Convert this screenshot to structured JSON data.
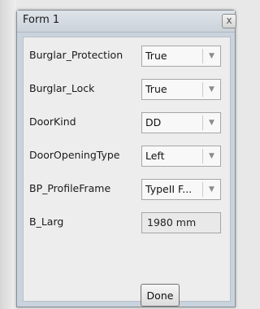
{
  "window": {
    "title": "Form 1",
    "close_symbol": "x"
  },
  "properties": [
    {
      "label": "Burglar_Protection",
      "control": "combo",
      "value": "True"
    },
    {
      "label": "Burglar_Lock",
      "control": "combo",
      "value": "True"
    },
    {
      "label": "DoorKind",
      "control": "combo",
      "value": "DD"
    },
    {
      "label": "DoorOpeningType",
      "control": "combo",
      "value": "Left"
    },
    {
      "label": "BP_ProfileFrame",
      "control": "combo",
      "value": "TypeII F..."
    },
    {
      "label": "B_Larg",
      "control": "textbox",
      "value": "1980 mm"
    }
  ],
  "dropdown_icon": "▼",
  "done_label": "Done"
}
